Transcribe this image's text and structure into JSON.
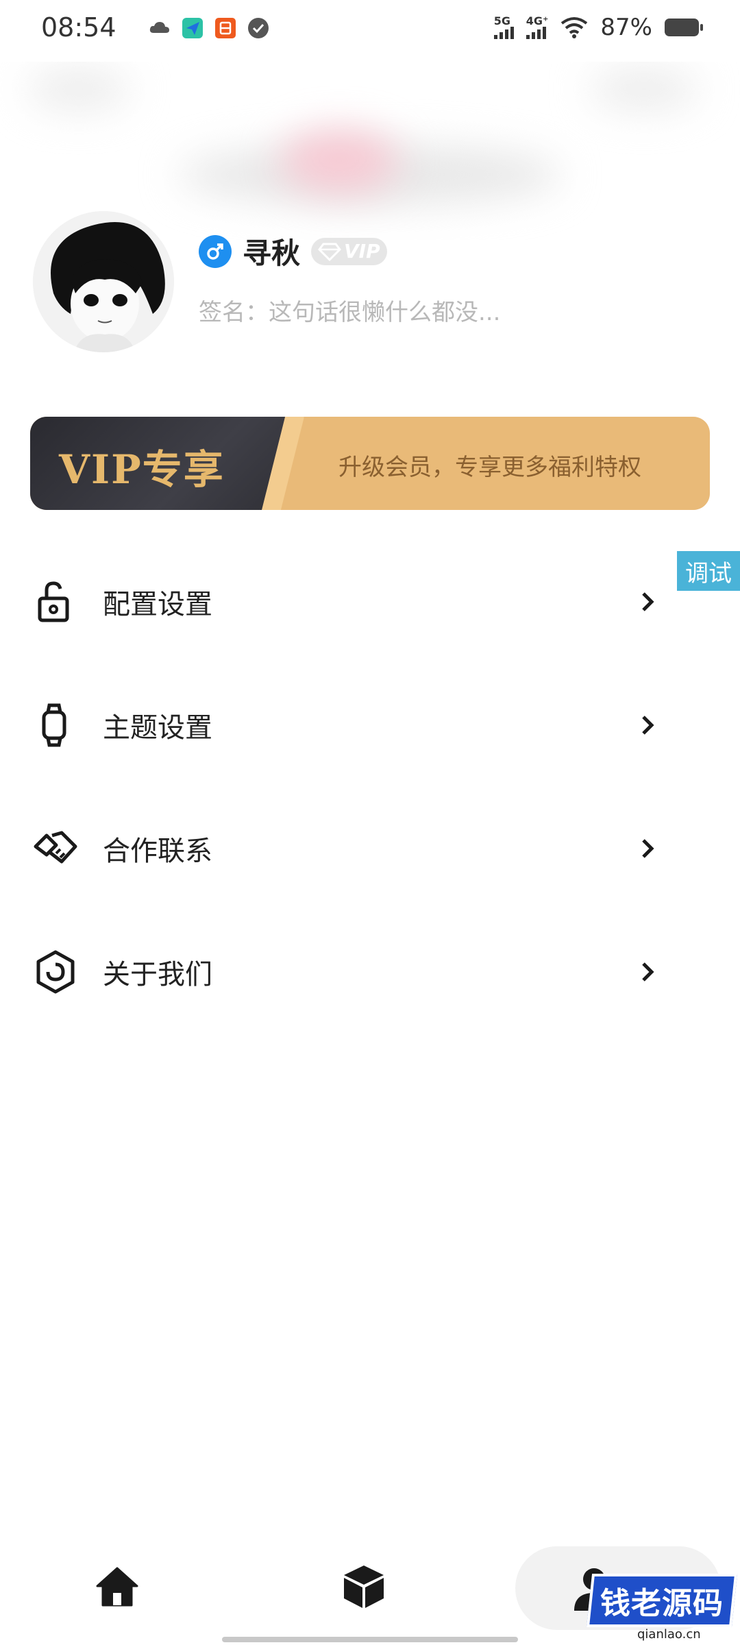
{
  "status_bar": {
    "time": "08:54",
    "net1": "5G",
    "net2": "4G⁺",
    "battery": "87%"
  },
  "profile": {
    "name": "寻秋",
    "vip_badge": "VIP",
    "signature": "签名：这句话很懒什么都没..."
  },
  "vip_banner": {
    "title": "VIP专享",
    "description": "升级会员，专享更多福利特权"
  },
  "debug_tag": "调试",
  "menu": {
    "items": [
      {
        "label": "配置设置",
        "icon": "unlock-icon"
      },
      {
        "label": "主题设置",
        "icon": "watch-icon"
      },
      {
        "label": "合作联系",
        "icon": "handshake-icon"
      },
      {
        "label": "关于我们",
        "icon": "hexagon-icon"
      }
    ]
  },
  "bottom_nav": {
    "tabs": [
      "home-icon",
      "box-icon",
      "profile-icon"
    ],
    "active": "profile-icon"
  },
  "watermark": {
    "brand": "钱老源码",
    "url": "qianlao.cn"
  },
  "colors": {
    "accent_blue": "#1e8ff0",
    "vip_gold": "#e9ba78",
    "vip_dark": "#2a2a30",
    "debug_blue": "#4ab3d8"
  }
}
